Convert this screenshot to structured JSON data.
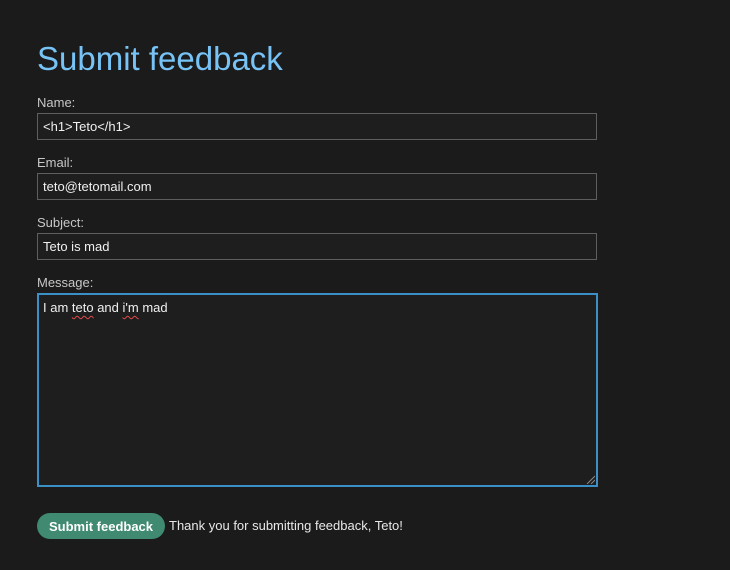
{
  "page": {
    "title": "Submit feedback"
  },
  "form": {
    "name": {
      "label": "Name:",
      "value": "<h1>Teto</h1>"
    },
    "email": {
      "label": "Email:",
      "value": "teto@tetomail.com"
    },
    "subject": {
      "label": "Subject:",
      "value": "Teto is mad"
    },
    "message": {
      "label": "Message:",
      "words": [
        "I am ",
        "teto",
        " and ",
        "i'm",
        " mad"
      ]
    },
    "submit_label": "Submit feedback",
    "status_message": "Thank you for submitting feedback, Teto!"
  },
  "colors": {
    "background": "#1b1b1b",
    "title": "#78c3f5",
    "focus_border": "#3d8fc7",
    "button": "#3f8a70",
    "spellcheck_underline": "#e04a4a"
  }
}
